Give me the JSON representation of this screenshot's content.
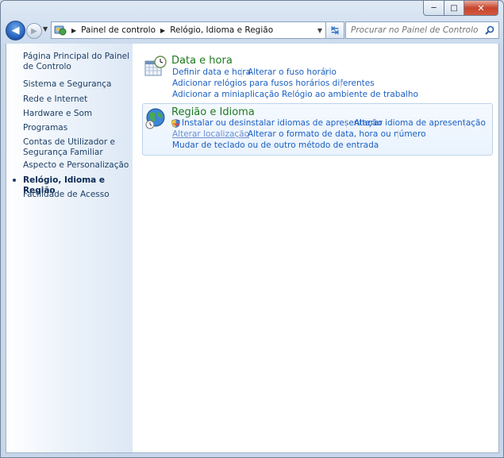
{
  "window": {
    "caption": {
      "minimize": "─",
      "maximize": "□",
      "close": "✕"
    }
  },
  "nav": {
    "back": "◀",
    "forward": "▶",
    "breadcrumb": [
      "Painel de controlo",
      "Relógio, Idioma e Região"
    ],
    "search_placeholder": "Procurar no Painel de Controlo"
  },
  "sidebar": {
    "home": "Página Principal do Painel de Controlo",
    "items": [
      "Sistema e Segurança",
      "Rede e Internet",
      "Hardware e Som",
      "Programas",
      "Contas de Utilizador e Segurança Familiar",
      "Aspecto e Personalização",
      "Relógio, Idioma e Região",
      "Facilidade de Acesso"
    ]
  },
  "categories": [
    {
      "title": "Data e hora",
      "links": [
        "Definir data e hora",
        "Alterar o fuso horário",
        "Adicionar relógios para fusos horários diferentes",
        "Adicionar a miniaplicação Relógio ao ambiente de trabalho"
      ]
    },
    {
      "title": "Região e Idioma",
      "links": [
        "Instalar ou desinstalar idiomas de apresentação",
        "Alterar idioma de apresentação",
        "Alterar localização",
        "Alterar o formato de data, hora ou número",
        "Mudar de teclado ou de outro método de entrada"
      ]
    }
  ],
  "colors": {
    "category_title": "#1e7a1e",
    "link": "#1b5fc1",
    "sidebar_text": "#1e3f66"
  }
}
